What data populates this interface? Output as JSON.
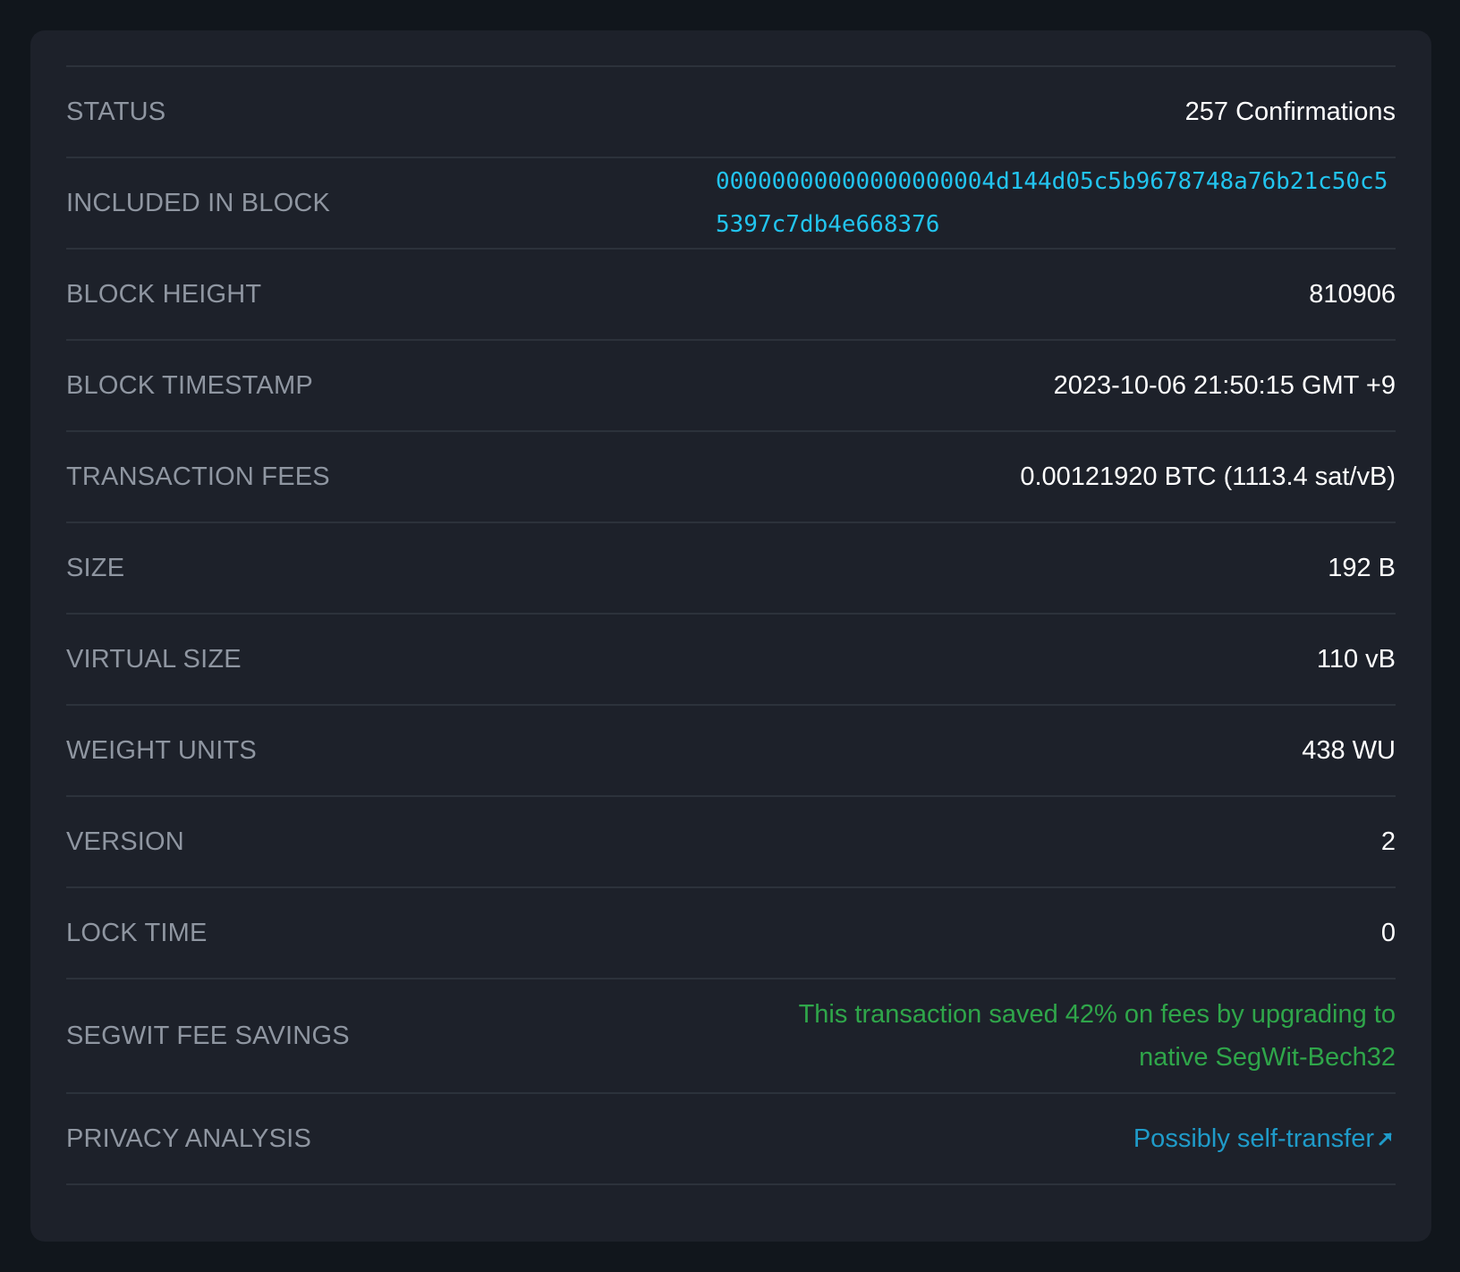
{
  "rows": {
    "status": {
      "label": "STATUS",
      "value": "257 Confirmations"
    },
    "block": {
      "label": "INCLUDED IN BLOCK",
      "value": "00000000000000000004d144d05c5b9678748a76b21c50c55397c7db4e668376"
    },
    "height": {
      "label": "BLOCK HEIGHT",
      "value": "810906"
    },
    "timestamp": {
      "label": "BLOCK TIMESTAMP",
      "value": "2023-10-06 21:50:15 GMT +9"
    },
    "fees": {
      "label": "TRANSACTION FEES",
      "value": "0.00121920 BTC (1113.4 sat/vB)"
    },
    "size": {
      "label": "SIZE",
      "value": "192 B"
    },
    "vsize": {
      "label": "VIRTUAL SIZE",
      "value": "110 vB"
    },
    "weight": {
      "label": "WEIGHT UNITS",
      "value": "438 WU"
    },
    "version": {
      "label": "VERSION",
      "value": "2"
    },
    "locktime": {
      "label": "LOCK TIME",
      "value": "0"
    },
    "segwit": {
      "label": "SEGWIT FEE SAVINGS",
      "value": "This transaction saved 42% on fees by upgrading to native SegWit-Bech32"
    },
    "privacy": {
      "label": "PRIVACY ANALYSIS",
      "value": "Possibly self-transfer",
      "icon": "external-link-icon"
    }
  },
  "colors": {
    "background": "#11161c",
    "card": "#1d212a",
    "divider": "#2c323b",
    "label": "#8f96a1",
    "value": "#ffffff",
    "hash_link": "#22c4ef",
    "savings": "#2fa64a",
    "privacy_link": "#1f9bc9"
  }
}
